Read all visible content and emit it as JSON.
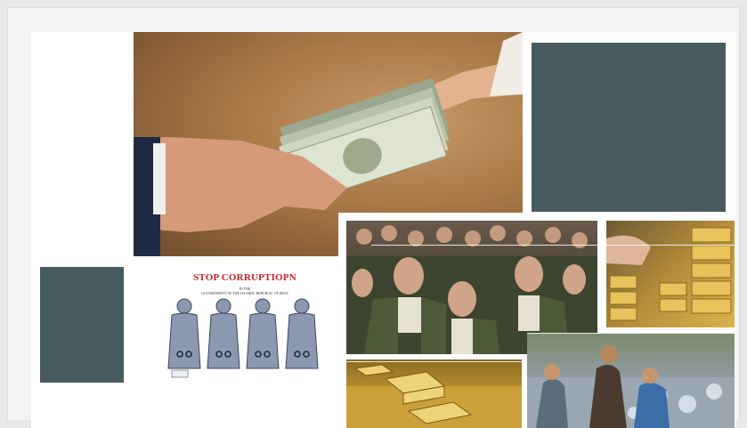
{
  "colors": {
    "page_background": "#e9e9e9",
    "frame_background": "#f4f4f4",
    "canvas_background": "#ffffff",
    "gray_block": "#475a60",
    "poster_title": "#c6202a"
  },
  "images": {
    "money": "hands-exchanging-dollar-bills-photo",
    "commanders": "military-commanders-group-photo",
    "gold_bars": "stacked-gold-bars-photo",
    "gold_pile": "gold-bars-on-gold-coins-photo",
    "children": "children-collecting-trash-photo"
  },
  "poster": {
    "title": "STOP CORRUPTIOPN",
    "subtitle_line1": "IN THE",
    "subtitle_line2": "GOVERNMENT OF THE ISLAMIC REPUBLIC OF IRAN"
  }
}
